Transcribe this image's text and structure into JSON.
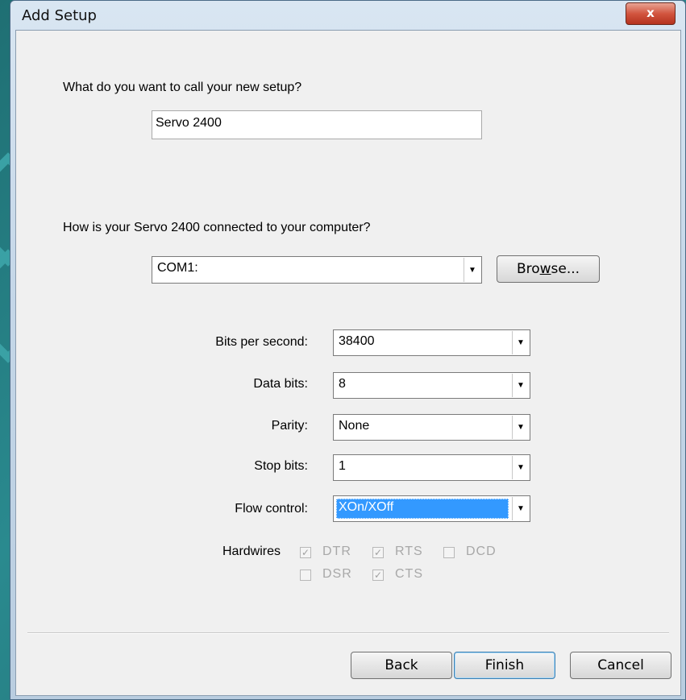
{
  "window": {
    "title": "Add Setup",
    "close_label": "x"
  },
  "setup_name": {
    "question": "What do you want to call your new setup?",
    "value": "Servo 2400"
  },
  "connection": {
    "question": "How is your Servo 2400 connected to your computer?",
    "port_value": "COM1:",
    "browse_label_pre": "Bro",
    "browse_label_accel": "w",
    "browse_label_post": "se..."
  },
  "settings": {
    "bits_per_second_label": "Bits per second:",
    "bits_per_second_value": "38400",
    "data_bits_label": "Data bits:",
    "data_bits_value": "8",
    "parity_label": "Parity:",
    "parity_value": "None",
    "stop_bits_label": "Stop bits:",
    "stop_bits_value": "1",
    "flow_control_label": "Flow control:",
    "flow_control_value": "XOn/XOff"
  },
  "hardwires": {
    "label": "Hardwires",
    "items": [
      {
        "label": "DTR",
        "checked": true
      },
      {
        "label": "RTS",
        "checked": true
      },
      {
        "label": "DCD",
        "checked": false
      },
      {
        "label": "DSR",
        "checked": false
      },
      {
        "label": "CTS",
        "checked": true
      }
    ]
  },
  "buttons": {
    "back": "Back",
    "finish": "Finish",
    "cancel": "Cancel"
  }
}
